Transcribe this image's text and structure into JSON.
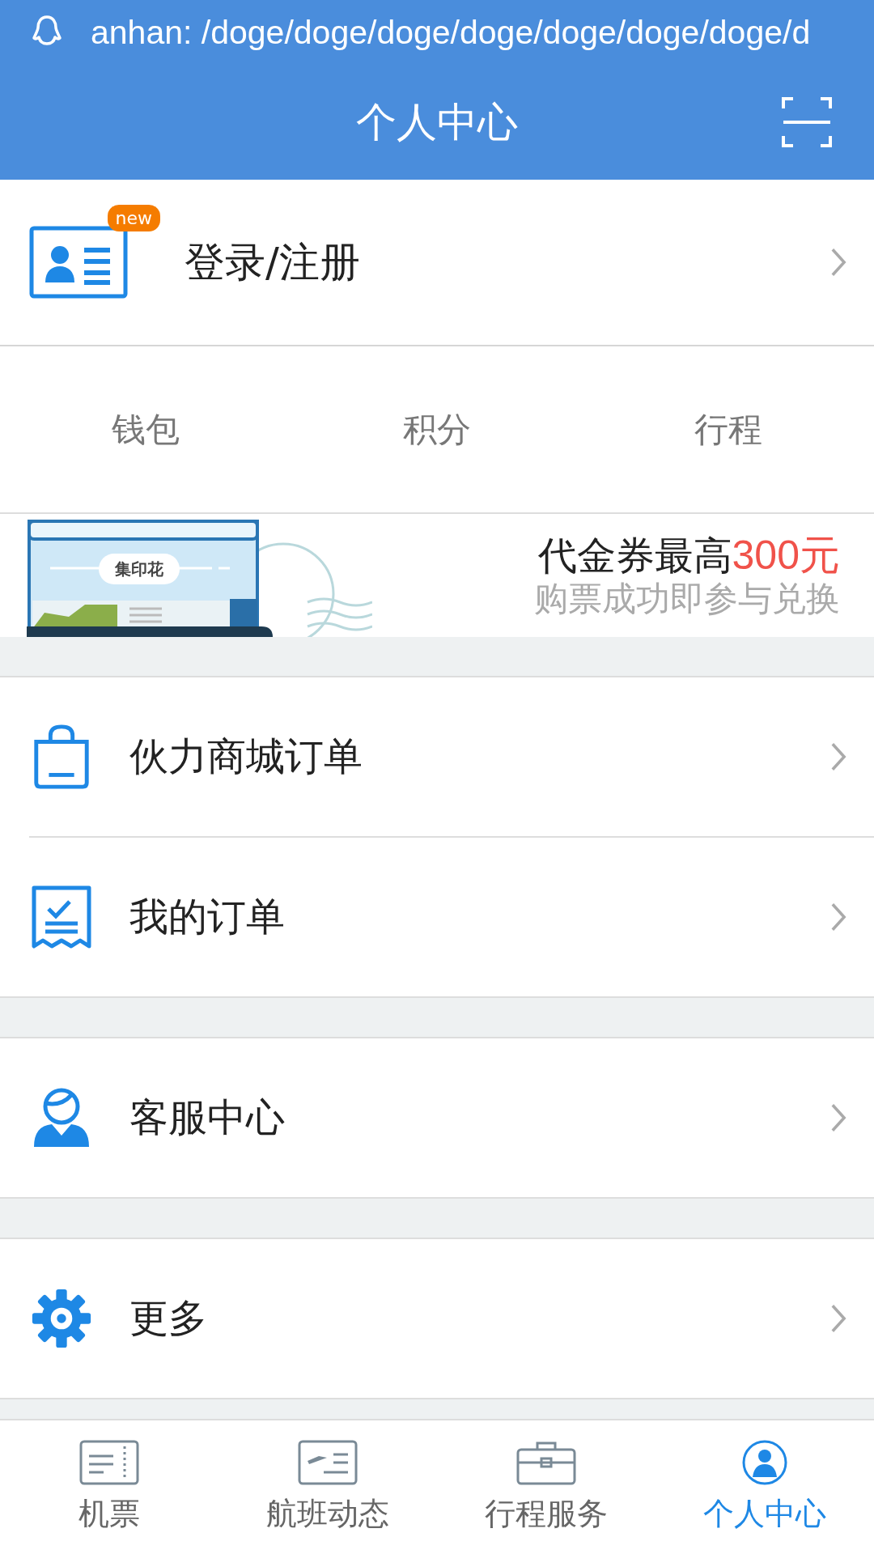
{
  "status_bar": {
    "notification": "anhan: /doge/doge/doge/doge/doge/doge/doge/d"
  },
  "header": {
    "title": "个人中心"
  },
  "login": {
    "label": "登录/注册",
    "badge": "new"
  },
  "stats": [
    {
      "label": "钱包"
    },
    {
      "label": "积分"
    },
    {
      "label": "行程"
    }
  ],
  "banner": {
    "stamp_label": "集印花",
    "headline": "代金券最高",
    "amount": "300元",
    "subline": "购票成功即参与兑换"
  },
  "groups": [
    [
      {
        "kind": "bag",
        "label": "伙力商城订单"
      },
      {
        "kind": "order",
        "label": "我的订单"
      }
    ],
    [
      {
        "kind": "service",
        "label": "客服中心"
      }
    ],
    [
      {
        "kind": "gear",
        "label": "更多"
      }
    ]
  ],
  "tabs": [
    {
      "kind": "ticket",
      "label": "机票",
      "selected": false
    },
    {
      "kind": "flight",
      "label": "航班动态",
      "selected": false
    },
    {
      "kind": "briefcase",
      "label": "行程服务",
      "selected": false
    },
    {
      "kind": "person",
      "label": "个人中心",
      "selected": true
    }
  ]
}
